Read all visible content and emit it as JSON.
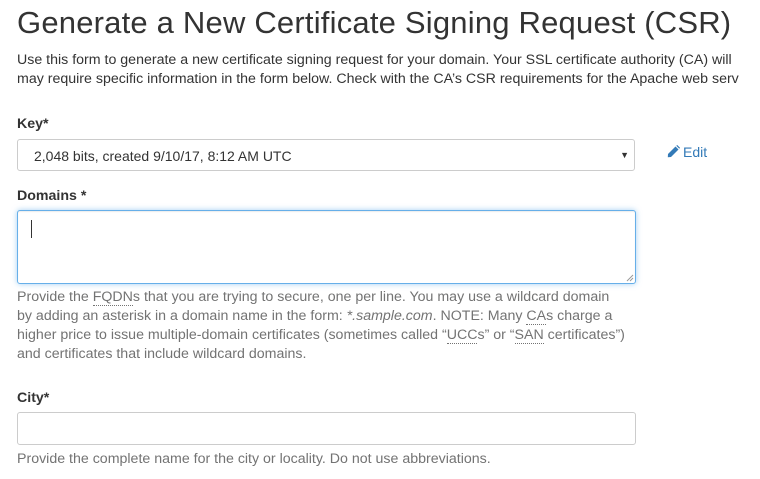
{
  "page": {
    "title": "Generate a New Certificate Signing Request (CSR)",
    "intro_line1": "Use this form to generate a new certificate signing request for your domain. Your SSL certificate authority (CA) will",
    "intro_line2": "may require specific information in the form below. Check with the CA’s CSR requirements for the Apache web serv"
  },
  "key": {
    "label": "Key*",
    "selected_value": "2,048 bits, created 9/10/17, 8:12 AM UTC",
    "arrow_icon": "caret-down-icon",
    "edit_label": "Edit",
    "edit_icon": "pencil-icon"
  },
  "domains": {
    "label": "Domains *",
    "value": "",
    "help": {
      "l1_a": "Provide the ",
      "l1_abbr": "FQDN",
      "l1_b": "s that you are trying to secure, one per line. You may use a wildcard domain",
      "l2_a": "by adding an asterisk in a domain name in the form: ",
      "l2_em": "*.sample.com",
      "l2_b": ". NOTE: Many ",
      "l2_abbr": "CA",
      "l2_c": "s charge a",
      "l3_a": "higher price to issue multiple-domain certificates (sometimes called “",
      "l3_abbr1": "UCC",
      "l3_b": "s” or “",
      "l3_abbr2": "SAN",
      "l3_c": " certificates”)",
      "l4": "and certificates that include wildcard domains."
    }
  },
  "city": {
    "label": "City*",
    "value": "",
    "help": "Provide the complete name for the city or locality. Do not use abbreviations."
  },
  "colors": {
    "link": "#337ab7",
    "focus_border": "#66afe9",
    "help_text": "#737373",
    "text": "#333333"
  }
}
